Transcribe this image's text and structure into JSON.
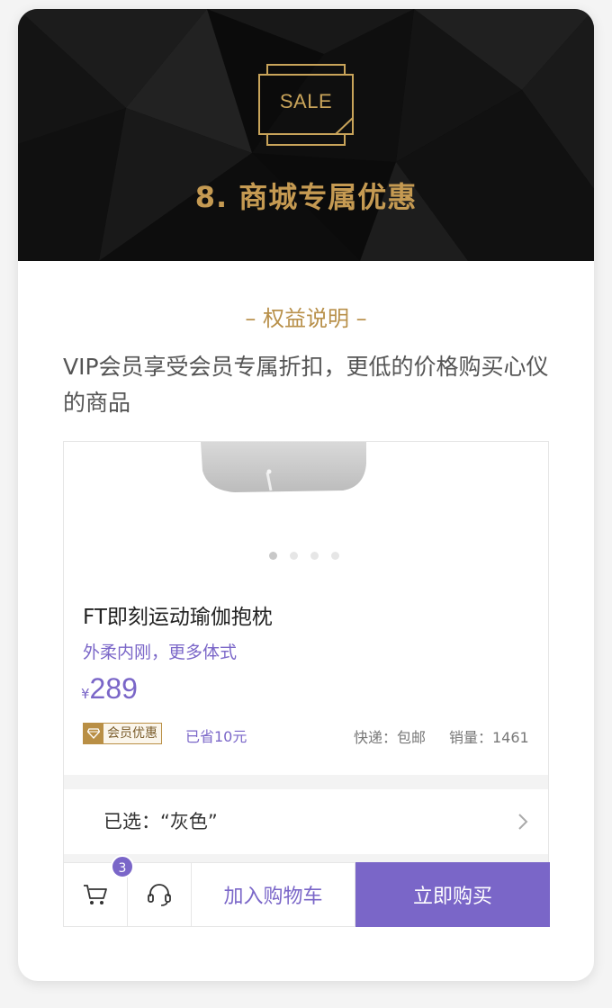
{
  "hero": {
    "badge_text": "SALE",
    "title": "8. 商城专属优惠"
  },
  "benefit": {
    "heading": "– 权益说明 –",
    "description": "VIP会员享受会员专属折扣，更低的价格购买心仪的商品"
  },
  "product": {
    "carousel": {
      "total": 4,
      "active": 1
    },
    "name": "FT即刻运动瑜伽抱枕",
    "subtitle": "外柔内刚，更多体式",
    "currency": "¥",
    "price": "289",
    "member_tag": "会员优惠",
    "saved": "已省10元",
    "shipping": "快递：包邮",
    "sales": "销量：1461",
    "selection": "已选：“灰色”"
  },
  "actions": {
    "cart_count": "3",
    "add_to_cart": "加入购物车",
    "buy_now": "立即购买"
  },
  "colors": {
    "accent": "#7a66c8",
    "gold": "#c59a52",
    "hero_bg": "#0b0b0b"
  },
  "icons": [
    "sale-badge-icon",
    "diamond-icon",
    "chevron-right-icon",
    "cart-icon",
    "headset-icon"
  ]
}
